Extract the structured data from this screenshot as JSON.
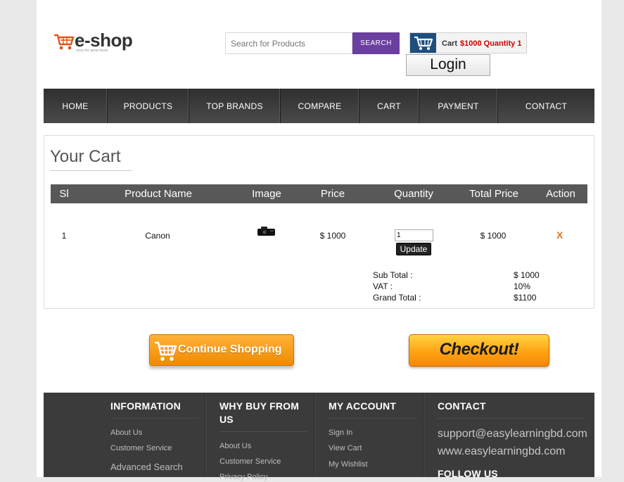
{
  "header": {
    "logo_text": "e-shop",
    "logo_tagline": "shop the great deals",
    "search_placeholder": "Search for Products",
    "search_button": "SEARCH",
    "cart_label": "Cart",
    "cart_summary": "$1000 Quantity 1",
    "login_button": "Login"
  },
  "nav": {
    "items": [
      "HOME",
      "PRODUCTS",
      "TOP BRANDS",
      "COMPARE",
      "CART",
      "PAYMENT",
      "CONTACT"
    ]
  },
  "cart": {
    "title": "Your Cart",
    "columns": [
      "Sl",
      "Product Name",
      "Image",
      "Price",
      "Quantity",
      "Total Price",
      "Action"
    ],
    "rows": [
      {
        "sl": "1",
        "product_name": "Canon",
        "image": "camera-icon",
        "price": "$ 1000",
        "quantity": "1",
        "total_price": "$ 1000",
        "action": "X"
      }
    ],
    "update_button": "Update",
    "summary": {
      "subtotal_label": "Sub Total :",
      "subtotal_value": "$ 1000",
      "vat_label": "VAT :",
      "vat_value": "10%",
      "grand_total_label": "Grand Total :",
      "grand_total_value": "$1100"
    }
  },
  "actions": {
    "continue_shopping": "Continue Shopping",
    "checkout": "Checkout!"
  },
  "footer": {
    "information": {
      "title": "INFORMATION",
      "links": [
        "About Us",
        "Customer Service",
        "Advanced Search"
      ]
    },
    "why_buy": {
      "title": "WHY BUY FROM US",
      "links": [
        "About Us",
        "Customer Service",
        "Privacy Policy"
      ]
    },
    "my_account": {
      "title": "MY ACCOUNT",
      "links": [
        "Sign In",
        "View Cart",
        "My Wishlist"
      ]
    },
    "contact": {
      "title": "CONTACT",
      "email": "support@easylearningbd.com",
      "website": "www.easylearningbd.com",
      "follow_title": "FOLLOW US"
    }
  },
  "colors": {
    "nav_bg": "#3d3d3d",
    "search_button": "#6b3fa0",
    "cart_icon_bg": "#1d4e7e",
    "cart_value": "#cc0000",
    "remove_x": "#e0761c",
    "continue_button": "#f59a14",
    "checkout_button": "#ffb020",
    "footer_bg": "#3b3b3b"
  }
}
